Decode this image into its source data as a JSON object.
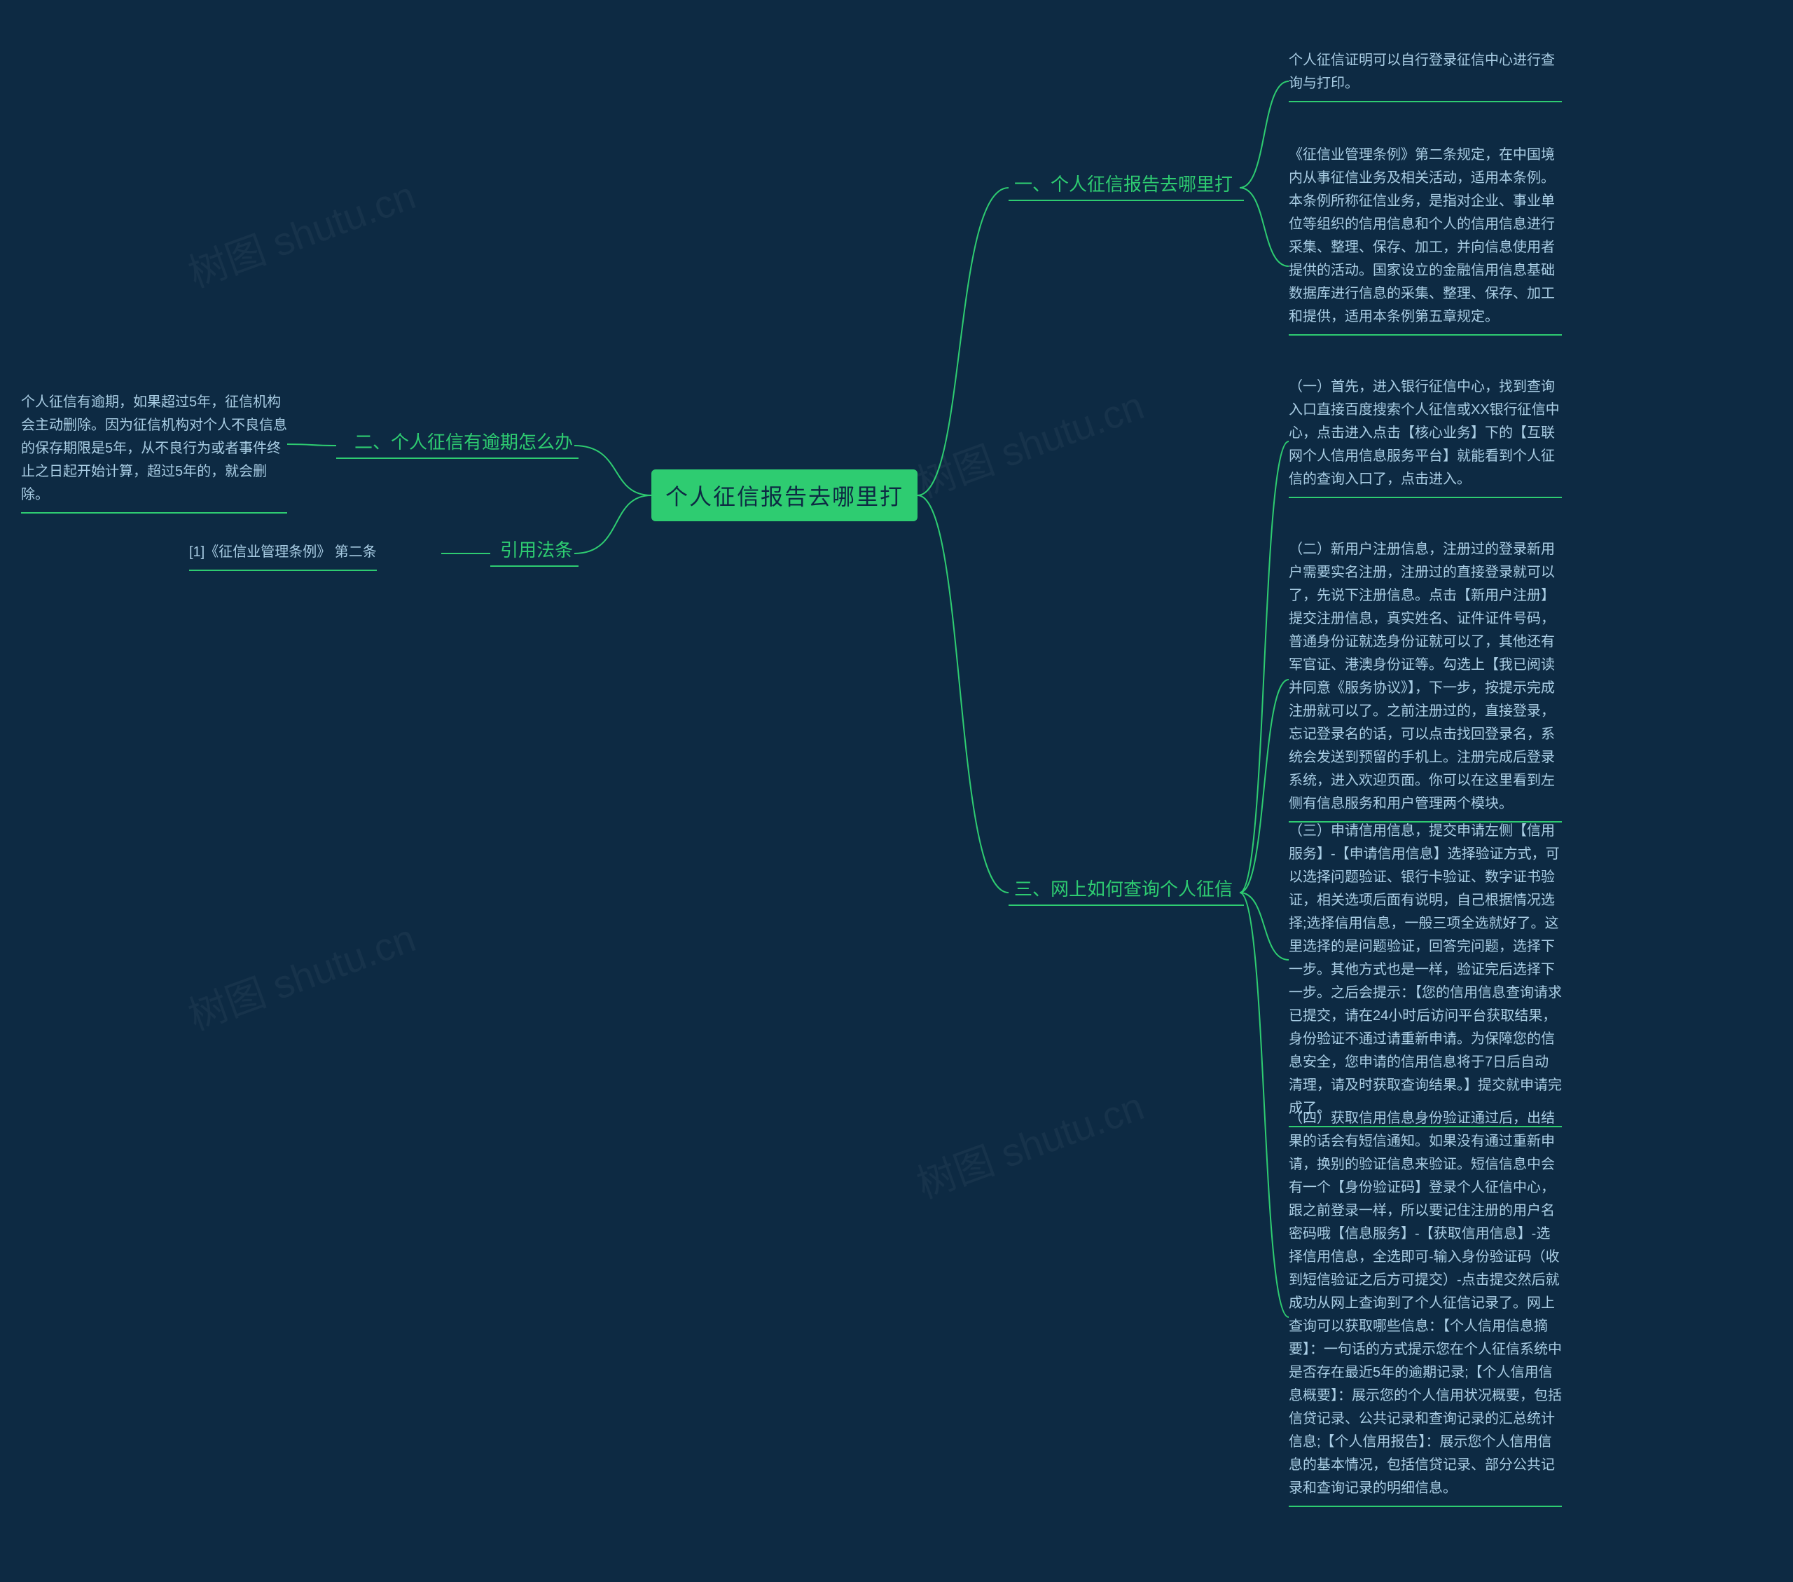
{
  "root": {
    "title": "个人征信报告去哪里打"
  },
  "left": {
    "b2": {
      "label": "二、个人征信有逾期怎么办",
      "detail": "个人征信有逾期，如果超过5年，征信机构会主动删除。因为征信机构对个人不良信息的保存期限是5年，从不良行为或者事件终止之日起开始计算，超过5年的，就会删除。"
    },
    "b_law": {
      "label": "引用法条",
      "ref": "[1]《征信业管理条例》 第二条"
    }
  },
  "right": {
    "b1": {
      "label": "一、个人征信报告去哪里打",
      "p1": "个人征信证明可以自行登录征信中心进行查询与打印。",
      "p2": "《征信业管理条例》第二条规定，在中国境内从事征信业务及相关活动，适用本条例。本条例所称征信业务，是指对企业、事业单位等组织的信用信息和个人的信用信息进行采集、整理、保存、加工，并向信息使用者提供的活动。国家设立的金融信用信息基础数据库进行信息的采集、整理、保存、加工和提供，适用本条例第五章规定。"
    },
    "b3": {
      "label": "三、网上如何查询个人征信",
      "p1": "（一）首先，进入银行征信中心，找到查询入口直接百度搜索个人征信或XX银行征信中心，点击进入点击【核心业务】下的【互联网个人信用信息服务平台】就能看到个人征信的查询入口了，点击进入。",
      "p2": "（二）新用户注册信息，注册过的登录新用户需要实名注册，注册过的直接登录就可以了，先说下注册信息。点击【新用户注册】提交注册信息，真实姓名、证件证件号码，普通身份证就选身份证就可以了，其他还有军官证、港澳身份证等。勾选上【我已阅读并同意《服务协议》】，下一步，按提示完成注册就可以了。之前注册过的，直接登录，忘记登录名的话，可以点击找回登录名，系统会发送到预留的手机上。注册完成后登录系统，进入欢迎页面。你可以在这里看到左侧有信息服务和用户管理两个模块。",
      "p3": "（三）申请信用信息，提交申请左侧【信用服务】-【申请信用信息】选择验证方式，可以选择问题验证、银行卡验证、数字证书验证，相关选项后面有说明，自己根据情况选择;选择信用信息，一般三项全选就好了。这里选择的是问题验证，回答完问题，选择下一步。其他方式也是一样，验证完后选择下一步。之后会提示：【您的信用信息查询请求已提交，请在24小时后访问平台获取结果，身份验证不通过请重新申请。为保障您的信息安全，您申请的信用信息将于7日后自动清理，请及时获取查询结果。】提交就申请完成了。",
      "p4": "（四）获取信用信息身份验证通过后，出结果的话会有短信通知。如果没有通过重新申请，换别的验证信息来验证。短信信息中会有一个【身份验证码】登录个人征信中心，跟之前登录一样，所以要记住注册的用户名密码哦【信息服务】-【获取信用信息】-选择信用信息，全选即可-输入身份验证码（收到短信验证之后方可提交）-点击提交然后就成功从网上查询到了个人征信记录了。网上查询可以获取哪些信息：【个人信用信息摘要】：一句话的方式提示您在个人征信系统中是否存在最近5年的逾期记录;【个人信用信息概要】：展示您的个人信用状况概要，包括信贷记录、公共记录和查询记录的汇总统计信息;【个人信用报告】：展示您个人信用信息的基本情况，包括信贷记录、部分公共记录和查询记录的明细信息。"
    }
  },
  "watermarks": [
    "树图 shutu.cn",
    "树图 shutu.cn",
    "树图 shutu.cn",
    "树图 shutu.cn"
  ]
}
